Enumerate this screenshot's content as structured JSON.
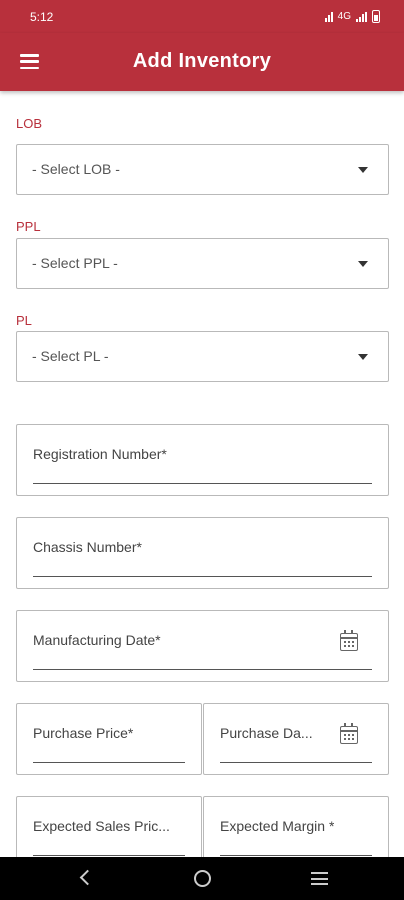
{
  "status_bar": {
    "time": "5:12",
    "indicators": "4G"
  },
  "app_bar": {
    "title": "Add Inventory",
    "menu_icon": "hamburger-menu-icon"
  },
  "form": {
    "lob": {
      "label": "LOB",
      "value": "- Select LOB -"
    },
    "ppl": {
      "label": "PPL",
      "value": "- Select PPL -"
    },
    "pl": {
      "label": "PL",
      "value": "- Select PL -"
    },
    "registration_number": {
      "placeholder": "Registration Number*"
    },
    "chassis_number": {
      "placeholder": "Chassis Number*"
    },
    "manufacturing_date": {
      "placeholder": "Manufacturing Date*",
      "icon": "calendar-icon"
    },
    "purchase_price": {
      "placeholder": "Purchase Price*"
    },
    "purchase_date": {
      "placeholder": "Purchase Da...",
      "icon": "calendar-icon"
    },
    "expected_sales_price": {
      "placeholder": "Expected Sales Pric..."
    },
    "expected_margin": {
      "placeholder": "Expected Margin *"
    }
  },
  "nav_bar": {
    "icons": [
      "back-icon",
      "home-icon",
      "recents-icon"
    ]
  },
  "colors": {
    "primary": "#b8303c",
    "border": "#b9b9b9"
  }
}
